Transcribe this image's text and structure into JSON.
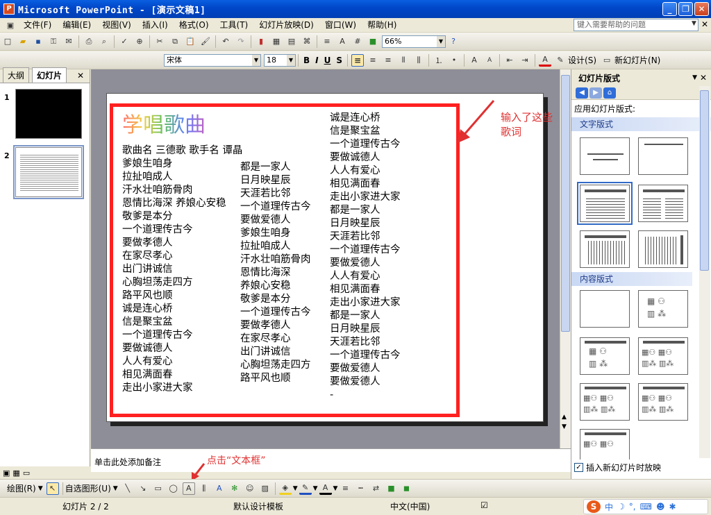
{
  "window": {
    "app_icon": "P",
    "title": "Microsoft PowerPoint - [演示文稿1]",
    "buttons": {
      "minimize": "_",
      "restore": "❐",
      "close": "✕"
    }
  },
  "menu": {
    "items": [
      "文件(F)",
      "编辑(E)",
      "视图(V)",
      "插入(I)",
      "格式(O)",
      "工具(T)",
      "幻灯片放映(D)",
      "窗口(W)",
      "帮助(H)"
    ],
    "help_placeholder": "键入需要帮助的问题"
  },
  "standard_toolbar": {
    "zoom": "66%"
  },
  "format_toolbar": {
    "font": "宋体",
    "size": "18",
    "bold": "B",
    "italic": "I",
    "underline": "U",
    "shadow": "S",
    "design_label": "设计(S)",
    "new_slide_label": "新幻灯片(N)"
  },
  "left_pane": {
    "tabs": [
      "大纲",
      "幻灯片"
    ],
    "close": "✕",
    "slide_numbers": [
      "1",
      "2"
    ]
  },
  "slide": {
    "title_art": "学唱歌曲",
    "info_line": "歌曲名 三德歌  歌手名 谭晶",
    "column1": [
      "爹娘生咱身",
      "拉扯咱成人",
      "汗水壮咱筋骨肉",
      "恩情比海深 养娘心安稳",
      "敬爹是本分",
      "一个道理传古今",
      "要做孝德人",
      "在家尽孝心",
      "出门讲诚信",
      "心胸坦荡走四方",
      "路平风也顺",
      "诚是连心桥",
      "信是聚宝盆",
      "一个道理传古今",
      "要做诚德人",
      "人人有爱心",
      "相见满面春",
      "走出小家进大家"
    ],
    "column2": [
      "都是一家人",
      "日月映星辰",
      "天涯若比邻",
      "一个道理传古今",
      "要做爱德人",
      "爹娘生咱身",
      "拉扯咱成人",
      "汗水壮咱筋骨肉",
      "恩情比海深",
      "养娘心安稳",
      "敬爹是本分",
      "一个道理传古今",
      "要做孝德人",
      "在家尽孝心",
      "出门讲诚信",
      "心胸坦荡走四方",
      "路平风也顺"
    ],
    "column3": [
      "诚是连心桥",
      "信是聚宝盆",
      "一个道理传古今",
      "要做诚德人",
      "人人有爱心",
      "相见满面春",
      "走出小家进大家",
      "都是一家人",
      "日月映星辰",
      "天涯若比邻",
      "一个道理传古今",
      "要做爱德人",
      "人人有爱心",
      "相见满面春",
      "走出小家进大家",
      "都是一家人",
      "日月映星辰",
      "天涯若比邻",
      "一个道理传古今",
      "要做爱德人",
      "要做爱德人",
      "-"
    ]
  },
  "annotations": {
    "lyrics_note": "输入了这些歌词",
    "textbox_note": "点击“文本框”"
  },
  "notes_placeholder": "单击此处添加备注",
  "task_pane": {
    "title": "幻灯片版式",
    "apply_label": "应用幻灯片版式:",
    "section_text": "文字版式",
    "section_content": "内容版式",
    "footer_checkbox": "插入新幻灯片时放映"
  },
  "draw_toolbar": {
    "draw_label": "绘图(R)",
    "autoshape_label": "自选图形(U)"
  },
  "status": {
    "slide": "幻灯片 2 / 2",
    "template": "默认设计模板",
    "language": "中文(中国)",
    "ime_label": "中"
  },
  "colors": {
    "red_frame": "#ff2020",
    "annotation": "#e03030",
    "title_bar": "#0046c8"
  }
}
